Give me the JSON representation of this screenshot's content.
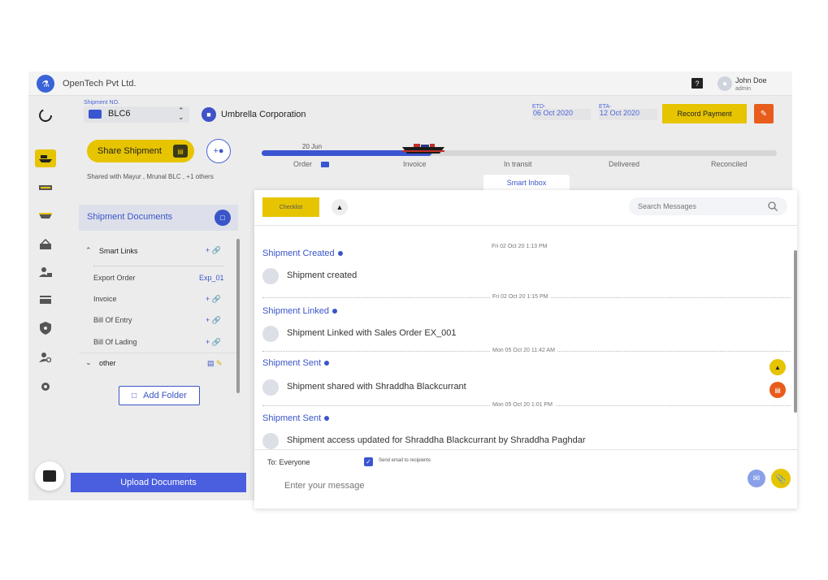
{
  "header": {
    "company": "OpenTech Pvt Ltd.",
    "user_name": "John Doe",
    "user_role": "admin",
    "help_label": "?"
  },
  "shipment": {
    "no_label": "Shipment NO.",
    "no_value": "BLC6",
    "customer": "Umbrella Corporation",
    "etd_label": "ETD-",
    "etd_value": "06 Oct 2020",
    "eta_label": "ETA-",
    "eta_value": "12 Oct 2020",
    "record_payment": "Record Payment"
  },
  "left_panel": {
    "share_button": "Share Shipment",
    "shared_with": "Shared with Mayur , Mrunal BLC , +1 others",
    "docs_title": "Shipment Documents",
    "smart_links": "Smart Links",
    "items": [
      {
        "label": "Export Order",
        "action": "Exp_01"
      },
      {
        "label": "Invoice",
        "action": ""
      },
      {
        "label": "Bill Of Entry",
        "action": ""
      },
      {
        "label": "Bill Of Lading",
        "action": ""
      }
    ],
    "other": "other",
    "add_folder": "Add Folder",
    "upload": "Upload Documents"
  },
  "timeline": {
    "date": "20 Jun",
    "steps": [
      "Order",
      "Invoice",
      "In transit",
      "Delivered",
      "Reconciled"
    ],
    "progress": 0.33
  },
  "inbox": {
    "tab": "Smart Inbox",
    "checklist": "Checklist",
    "search_placeholder": "Search Messages",
    "events": [
      {
        "ts": "Fri 02 Oct 20 1:13 PM",
        "title": "Shipment Created",
        "text": "Shipment created"
      },
      {
        "ts": "Fri 02 Oct 20 1:15 PM",
        "title": "Shipment Linked",
        "text": "Shipment Linked with Sales Order EX_001"
      },
      {
        "ts": "Mon 05 Oct 20 11:42 AM",
        "title": "Shipment Sent",
        "text": "Shipment shared with Shraddha Blackcurrant"
      },
      {
        "ts": "Mon 05 Oct 20 1:01 PM",
        "title": "Shipment Sent",
        "text": "Shipment access updated for Shraddha Blackcurrant by Shraddha Paghdar"
      }
    ],
    "to": "To: Everyone",
    "send_email": "Send email to recipients",
    "message_placeholder": "Enter your message"
  },
  "colors": {
    "accent_blue": "#3a55d0",
    "accent_yellow": "#e6c400",
    "accent_orange": "#e85c1c"
  }
}
